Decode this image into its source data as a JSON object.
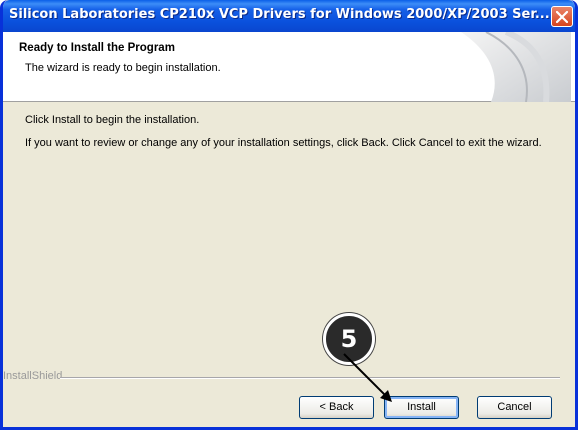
{
  "window": {
    "title": "Silicon Laboratories CP210x VCP Drivers for Windows 2000/XP/2003 Ser..."
  },
  "header": {
    "title": "Ready to Install the Program",
    "subtitle": "The wizard is ready to begin installation."
  },
  "body": {
    "line1": "Click Install to begin the installation.",
    "line2": "If you want to review or change any of your installation settings, click Back. Click Cancel to exit the wizard."
  },
  "footer": {
    "brand": "InstallShield"
  },
  "buttons": {
    "back": "< Back",
    "install": "Install",
    "cancel": "Cancel"
  },
  "annotation": {
    "step": "5"
  },
  "colors": {
    "titlebar": "#0a50dc",
    "dialog_bg": "#ece9d8",
    "close": "#d7441e"
  }
}
